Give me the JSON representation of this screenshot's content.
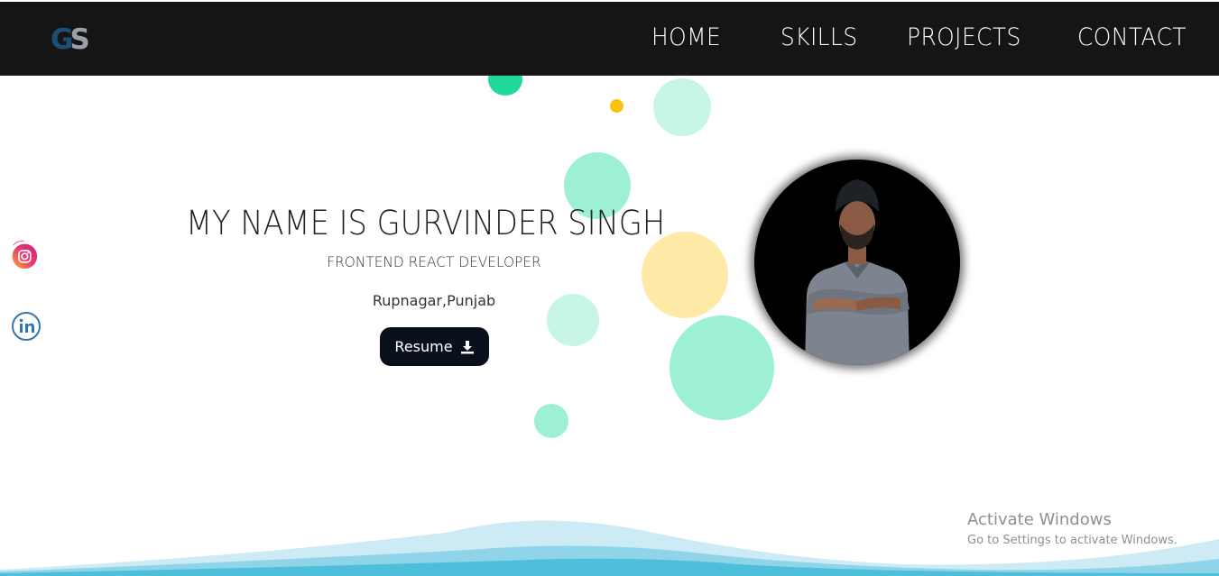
{
  "header": {
    "logo_text": "GS",
    "nav": [
      {
        "label": "HOME"
      },
      {
        "label": "SKILLS"
      },
      {
        "label": "PROJECTS"
      },
      {
        "label": "CONTACT"
      }
    ]
  },
  "hero": {
    "title": "MY NAME IS GURVINDER SINGH",
    "subtitle": "FRONTEND REACT DEVELOPER",
    "location": "Rupnagar,Punjab",
    "resume_label": "Resume",
    "resume_icon": "download-icon"
  },
  "social": [
    {
      "name": "instagram-icon"
    },
    {
      "name": "linkedin-icon"
    }
  ],
  "watermark": {
    "title": "Activate Windows",
    "subtitle": "Go to Settings to activate Windows."
  },
  "colors": {
    "navbar_bg": "#151515",
    "button_bg": "#0a0f1c",
    "bubble_teal": "#9ef0d4",
    "bubble_yellow": "#ffe9a6",
    "wave": "#4ebfdb"
  }
}
